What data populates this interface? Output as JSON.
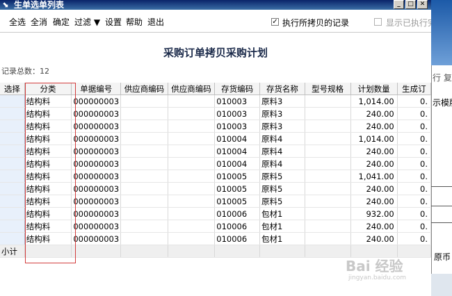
{
  "window": {
    "title": "生单选单列表"
  },
  "toolbar": {
    "items": [
      "全选",
      "全消",
      "确定",
      "过滤 ▼",
      "设置",
      "帮助",
      "退出"
    ],
    "checkbox_copied": {
      "label": "执行所拷贝的记录",
      "checked": true
    },
    "checkbox_show_executed": {
      "label": "显示已执行完"
    }
  },
  "report": {
    "title": "采购订单拷贝采购计划",
    "record_count": "记录总数：12"
  },
  "grid": {
    "columns": [
      "选择",
      "分类",
      "单据编号",
      "供应商编码",
      "供应商编码",
      "存货编码",
      "存货名称",
      "型号规格",
      "计划数量",
      "生成订"
    ],
    "rows": [
      [
        "",
        "结构料",
        "000000003",
        "",
        "",
        "010003",
        "原料3",
        "",
        "1,014.00",
        "0."
      ],
      [
        "",
        "结构料",
        "000000003",
        "",
        "",
        "010003",
        "原料3",
        "",
        "240.00",
        "0."
      ],
      [
        "",
        "结构料",
        "000000003",
        "",
        "",
        "010003",
        "原料3",
        "",
        "240.00",
        "0."
      ],
      [
        "",
        "结构料",
        "000000003",
        "",
        "",
        "010004",
        "原料4",
        "",
        "1,014.00",
        "0."
      ],
      [
        "",
        "结构料",
        "000000003",
        "",
        "",
        "010004",
        "原料4",
        "",
        "240.00",
        "0."
      ],
      [
        "",
        "结构料",
        "000000003",
        "",
        "",
        "010004",
        "原料4",
        "",
        "240.00",
        "0."
      ],
      [
        "",
        "结构料",
        "000000003",
        "",
        "",
        "010005",
        "原料5",
        "",
        "1,041.00",
        "0."
      ],
      [
        "",
        "结构料",
        "000000003",
        "",
        "",
        "010005",
        "原料5",
        "",
        "240.00",
        "0."
      ],
      [
        "",
        "结构料",
        "000000003",
        "",
        "",
        "010005",
        "原料5",
        "",
        "240.00",
        "0."
      ],
      [
        "",
        "结构料",
        "000000003",
        "",
        "",
        "010006",
        "包材1",
        "",
        "932.00",
        "0."
      ],
      [
        "",
        "结构料",
        "000000003",
        "",
        "",
        "010006",
        "包材1",
        "",
        "240.00",
        "0."
      ],
      [
        "",
        "结构料",
        "000000003",
        "",
        "",
        "010006",
        "包材1",
        "",
        "240.00",
        "0."
      ]
    ],
    "subtotal_label": "小计"
  },
  "background_app": {
    "label_1": "行 复",
    "label_2": "示模版",
    "label_3": "原币"
  },
  "watermark": {
    "line1": "Bai 经验",
    "line2": "jingyan.baidu.com"
  }
}
